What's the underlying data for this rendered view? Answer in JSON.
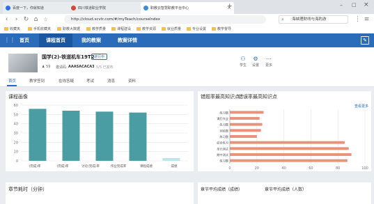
{
  "browser": {
    "tabs": [
      {
        "label": "百度一下，你就知道",
        "active": false
      },
      {
        "label": "四川铁道职业学院",
        "active": false
      },
      {
        "label": "职教云智慧职教平台中心",
        "active": true
      }
    ],
    "url": "http://cloud.scvtr.com/#/myTeach/courseIndex",
    "search_value": "海峡理财线与海豹游",
    "bookmarks": [
      "收藏夹",
      "手机收藏夹",
      "职教大数据",
      "教学质量",
      "课程建设",
      "教学资源",
      "就业质量",
      "专业设置",
      "教学督导"
    ]
  },
  "appnav": {
    "home": "首页",
    "course_home": "课程首页",
    "my_teach": "我的教案",
    "teach_design": "教案详情"
  },
  "course": {
    "title": "国学(2)-铁道机车19T2",
    "badge": "进行中",
    "meta_a": "59",
    "meta_label": "邀请码:",
    "meta_code": "AAASACACA3",
    "meta_status": "5/5  已发布",
    "actions": [
      "学生",
      "设置",
      "更多"
    ]
  },
  "tabs": [
    "首页",
    "教学签到",
    "在线答疑",
    "考试",
    "消息",
    "资料"
  ],
  "cards": {
    "portrait": "课程画像",
    "wrong_kp": "错题率最高知识点",
    "hot_kp": "错误率最高知识点",
    "more": "查看更多",
    "section_time": "章节耗时（分钟）",
    "avg_score": "章节平均成绩（成绩）",
    "avg_count": "章节平均成绩（人数）"
  },
  "chart_data": [
    {
      "type": "bar",
      "categories": [
        "(完成)率",
        "(完成)率",
        "讨论(完成)率",
        "作业完成率",
        "成绩"
      ],
      "x_tick_labels": [
        "(完成)率",
        "(完成)率",
        "讨论(完成)率",
        "作业完成率",
        "课程成绩",
        "成绩"
      ],
      "values": [
        56,
        54,
        53,
        52,
        3
      ],
      "colors": [
        "#4a9ea3",
        "#4a9ea3",
        "#4a9ea3",
        "#4a9ea3",
        "#bfe4ea"
      ],
      "ylim": [
        0,
        60
      ],
      "yticks": [
        0,
        10,
        20,
        30,
        40,
        50,
        60
      ],
      "grid": true
    },
    {
      "type": "bar",
      "orientation": "horizontal",
      "categories": [
        "练习题",
        "课后作业",
        "练习题",
        "测验题",
        "练习题",
        "综合练习",
        "单元测试",
        "期中测试",
        "练习题"
      ],
      "values": [
        25,
        22,
        24,
        23,
        20,
        85,
        88,
        90,
        87
      ],
      "xlim": [
        0,
        100
      ],
      "xticks": [
        0,
        20,
        40,
        60,
        80,
        100
      ],
      "bar_color": "#e8927c",
      "grid": true
    }
  ]
}
